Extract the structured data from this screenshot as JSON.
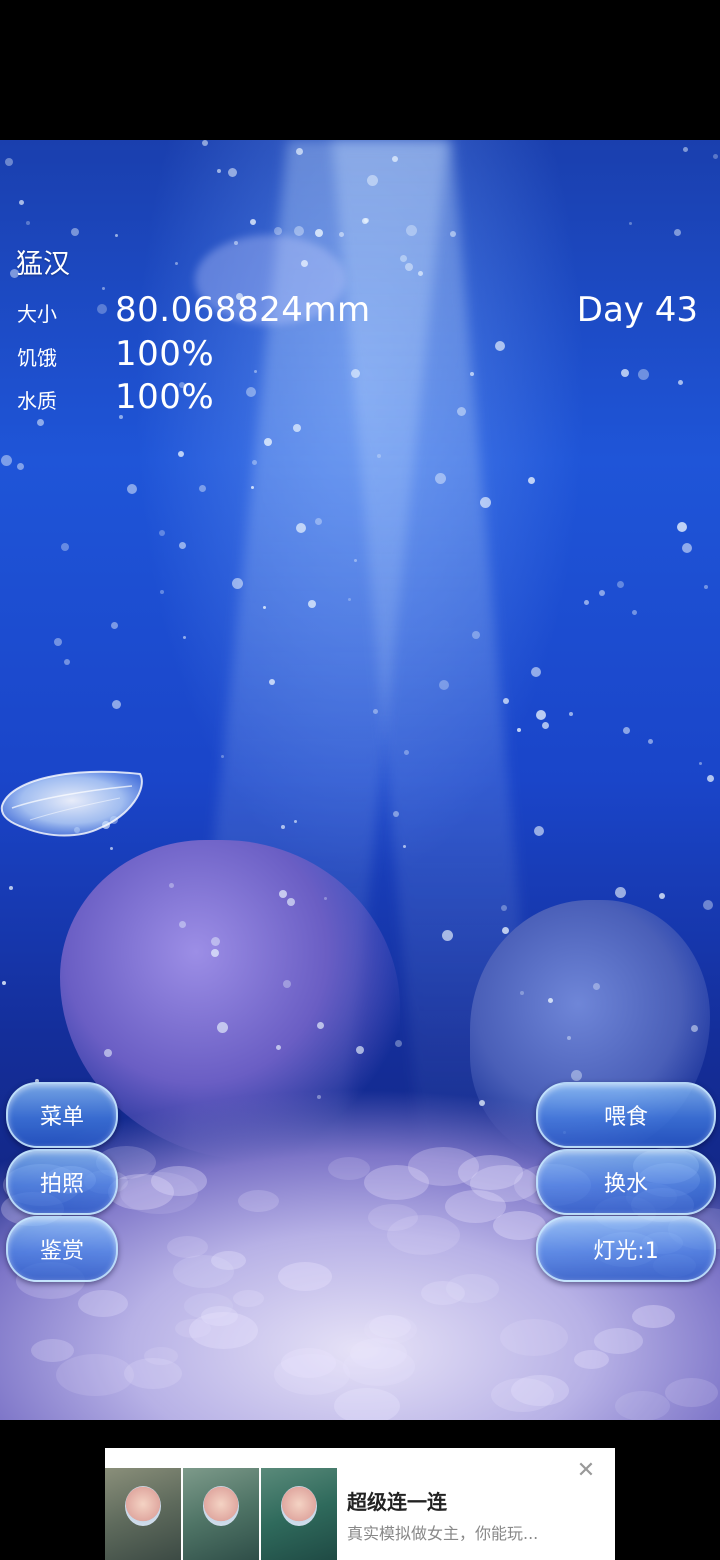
{
  "pet": {
    "name": "猛汉",
    "size_label": "大小",
    "size_value": "80.068824mm",
    "hunger_label": "饥饿",
    "hunger_value": "100%",
    "water_label": "水质",
    "water_value": "100%",
    "day": "Day 43"
  },
  "left_buttons": {
    "menu": "菜单",
    "photo": "拍照",
    "gallery": "鉴赏"
  },
  "right_buttons": {
    "feed": "喂食",
    "change_water": "换水",
    "light": "灯光:1"
  },
  "ad": {
    "title": "超级连一连",
    "subtitle": "真实模拟做女主，你能玩...",
    "close_icon": "close-icon"
  }
}
